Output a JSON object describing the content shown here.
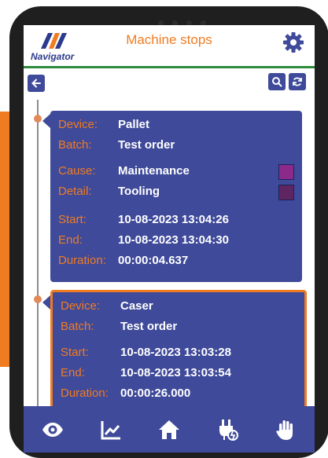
{
  "app": {
    "logo_text": "Navigator",
    "title": "Machine stops"
  },
  "colors": {
    "accent": "#f07c22",
    "primary": "#3f4a9a",
    "divider": "#2e8b3d",
    "cause_color": "#8b2a8b",
    "detail_color": "#5e2560"
  },
  "labels": {
    "device": "Device:",
    "batch": "Batch:",
    "cause": "Cause:",
    "detail": "Detail:",
    "start": "Start:",
    "end": "End:",
    "duration": "Duration:"
  },
  "stops": [
    {
      "device": "Pallet",
      "batch": "Test order",
      "cause": "Maintenance",
      "detail": "Tooling",
      "start": "10-08-2023 13:04:26",
      "end": "10-08-2023 13:04:30",
      "duration": "00:00:04.637"
    },
    {
      "device": "Caser",
      "batch": "Test order",
      "start": "10-08-2023 13:03:28",
      "end": "10-08-2023 13:03:54",
      "duration": "00:00:26.000"
    }
  ],
  "icons": {
    "back": "arrow-left-icon",
    "search": "search-icon",
    "refresh": "refresh-icon",
    "settings": "gear-icon",
    "nav": [
      "eye-icon",
      "chart-line-icon",
      "home-icon",
      "plug-off-icon",
      "hand-stop-icon"
    ]
  }
}
